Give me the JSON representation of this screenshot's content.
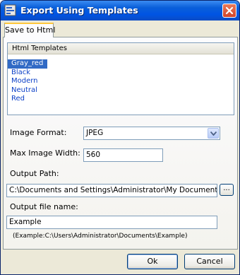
{
  "window": {
    "title": "Export Using Templates"
  },
  "tabs": [
    {
      "label": "Save to Html"
    }
  ],
  "templates": {
    "header": "Html Templates",
    "items": [
      "Gray_red",
      "Black",
      "Modern",
      "Neutral",
      "Red"
    ],
    "selected": "Gray_red"
  },
  "form": {
    "image_format_label": "Image Format:",
    "image_format_value": "JPEG",
    "max_width_label": "Max Image Width:",
    "max_width_value": "560",
    "output_path_label": "Output Path:",
    "output_path_value": "C:\\Documents and Settings\\Administrator\\My Documents",
    "browse_label": "...",
    "output_name_label": "Output file name:",
    "output_name_value": "Example",
    "hint": "(Example:C:\\Users\\Administrator\\Documents\\Example)"
  },
  "buttons": {
    "ok": "Ok",
    "cancel": "Cancel"
  },
  "colors": {
    "titlebar": "#0054e3",
    "selection": "#316ac5",
    "list_text": "#0b3fc7",
    "close": "#d2442a"
  },
  "icons": {
    "app": "export-app-icon",
    "close": "close-icon",
    "dropdown": "chevron-down-icon"
  }
}
